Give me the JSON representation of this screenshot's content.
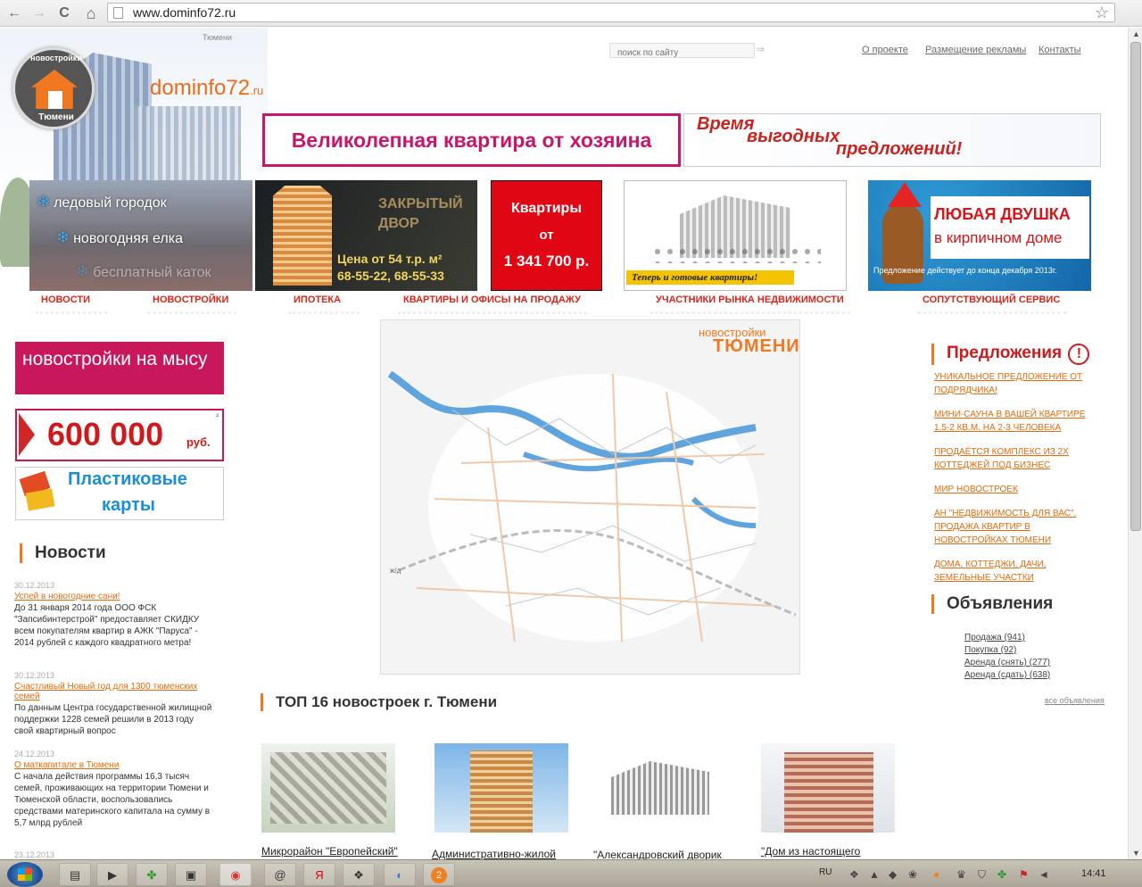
{
  "browser": {
    "url": "www.dominfo72.ru",
    "back": "←",
    "forward": "→",
    "reload": "C",
    "home": "⌂",
    "star": "☆"
  },
  "header": {
    "city": "Тюмени",
    "logo_top": "новостройки",
    "logo_bottom": "Тюмени",
    "site_name": "dominfo72",
    "site_tld": ".ru",
    "search_placeholder": "поиск по сайту",
    "links": [
      "О проекте",
      "Размещение рекламы",
      "Контакты"
    ]
  },
  "banners": {
    "main": "Великолепная квартира от хозяина",
    "time": [
      "Время",
      "выгодных",
      "предложений!"
    ]
  },
  "promos": {
    "ice": [
      "ледовый городок",
      "новогодняя елка",
      "бесплатный каток"
    ],
    "yard": [
      "ЗАКРЫТЫЙ",
      "ДВОР",
      "Цена от 54 т.р. м²",
      "68-55-22, 68-55-33"
    ],
    "red": [
      "Квартиры",
      "от",
      "1 341 700 р."
    ],
    "ready": "Теперь и готовые квартиры!",
    "horse": [
      "ЛЮБАЯ ДВУШКА",
      "в кирпичном доме",
      "Предложение действует до конца декабря 2013г."
    ]
  },
  "main_nav": [
    "НОВОСТИ",
    "НОВОСТРОЙКИ",
    "ИПОТЕКА",
    "КВАРТИРЫ И ОФИСЫ НА ПРОДАЖУ",
    "УЧАСТНИКИ РЫНКА НЕДВИЖИМОСТИ",
    "СОПУТСТВУЮЩИЙ СЕРВИС"
  ],
  "left_banners": {
    "new_cape": "новостройки на мысу",
    "amount": "600 000",
    "currency": "руб.",
    "amount_note": "²",
    "cards_1": "Пластиковые",
    "cards_2": "карты"
  },
  "news": {
    "title": "Новости",
    "items": [
      {
        "date": "30.12.2013",
        "link": "Успей в новогодние сани!",
        "text": "До 31 января 2014 года ООО ФСК \"Запсибинтерстрой\" предоставляет СКИДКУ всем покупателям квартир в АЖК \"Паруса\" - 2014 рублей с каждого квадратного метра!"
      },
      {
        "date": "30.12.2013",
        "link": "Счастливый Новый год для 1300 тюменских семей",
        "text": "По данным Центра государственной жилищной поддержки 1228 семей решили в 2013 году свой квартирный вопрос"
      },
      {
        "date": "24.12.2013",
        "link": "О маткапитале в Тюмени",
        "text": "С начала действия программы 16,3 тысяч семей, проживающих на территории Тюмени и Тюменской области, воспользовались средствами материнского капитала на сумму в 5,7 млрд рублей"
      },
      {
        "date": "23.12.2013",
        "link": "",
        "text": ""
      }
    ]
  },
  "map": {
    "logo_top": "новостройки",
    "logo_bottom": "ТЮМЕНИ",
    "rail": "ж/д"
  },
  "offers": {
    "title": "Предложения",
    "items": [
      "УНИКАЛЬНОЕ ПРЕДЛОЖЕНИЕ ОТ ПОДРЯДЧИКА!",
      "МИНИ-САУНА В ВАШЕЙ КВАРТИРЕ 1,5-2 КВ.М. НА 2-3 ЧЕЛОВЕКА",
      "ПРОДАЁТСЯ КОМПЛЕКС ИЗ 2Х КОТТЕДЖЕЙ ПОД БИЗНЕС",
      "МИР НОВОСТРОЕК",
      "АН \"НЕДВИЖИМОСТЬ ДЛЯ ВАС\". ПРОДАЖА КВАРТИР В НОВОСТРОЙКАХ ТЮМЕНИ",
      "ДОМА, КОТТЕДЖИ, ДАЧИ, ЗЕМЕЛЬНЫЕ УЧАСТКИ"
    ]
  },
  "ads": {
    "title": "Объявления",
    "items": [
      "Продажа (941)",
      "Покупка (92)",
      "Аренда (снять) (277)",
      "Аренда (сдать) (638)"
    ],
    "all": "все объявления"
  },
  "top16": {
    "title": "ТОП 16 новостроек г. Тюмени",
    "captions": [
      "Микрорайон \"Европейский\"",
      "Административно-жилой",
      "\"Александровский дворик",
      "\"Дом из настоящего"
    ]
  },
  "taskbar": {
    "lang": "RU",
    "clock": "14:41",
    "badge": "2"
  }
}
